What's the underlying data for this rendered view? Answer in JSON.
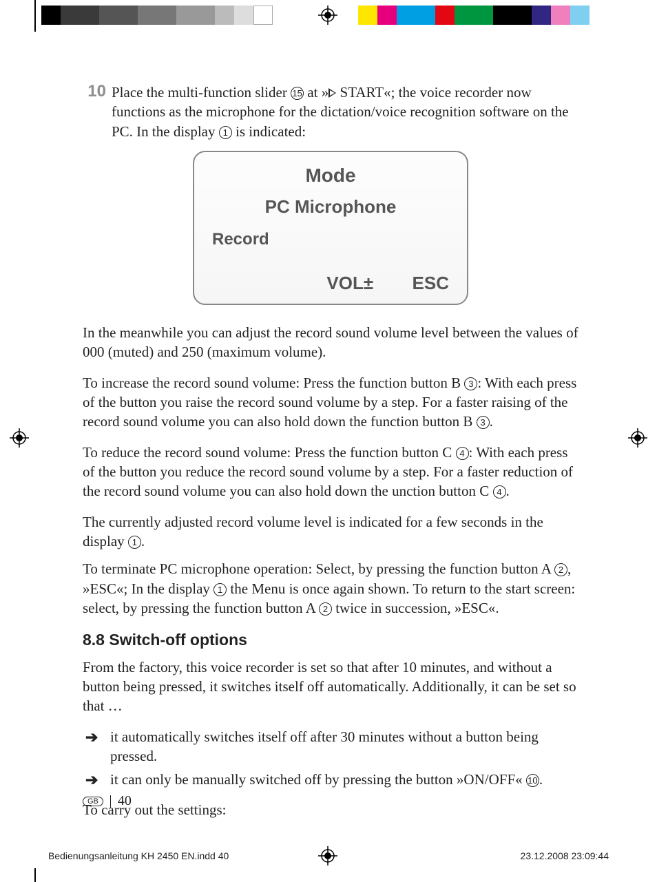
{
  "step": {
    "number": "10",
    "text_a": "Place the multi-function slider ",
    "ref15": "15",
    "text_b": " at »",
    "text_c": " START«; the voice recorder now functions as the microphone for the dictation/voice recognition software on the PC. In the display ",
    "ref1": "1",
    "text_d": " is indicated:"
  },
  "lcd": {
    "mode": "Mode",
    "sub": "PC Microphone",
    "rec": "Record",
    "vol": "VOL±",
    "esc": "ESC"
  },
  "p1": "In the meanwhile you can adjust the record sound volume level between the values of 000 (muted) and 250 (maximum volume).",
  "p2": {
    "a": "To increase the record sound volume: Press the function button B ",
    "ref3a": "3",
    "b": ": With each press of the button you raise the record sound volume by a step. For a faster raising of the record sound volume you can also hold down the function button B ",
    "ref3b": "3",
    "c": "."
  },
  "p3": {
    "a": "To reduce the record sound volume: Press the function button C ",
    "ref4a": "4",
    "b": ": With each press of the button you reduce the record sound volume by a step. For a faster reduction of the record sound volume you can also hold down the unction button C ",
    "ref4b": "4",
    "c": "."
  },
  "p4": {
    "a": "The currently adjusted record volume level is indicated for a few seconds in the display ",
    "ref1": "1",
    "b": "."
  },
  "p5": {
    "a": "To terminate PC microphone operation: Select, by pressing the function button A ",
    "ref2a": "2",
    "b": ", »ESC«; In the display ",
    "ref1": "1",
    "c": " the Menu is once again shown. To return to the start screen: select, by pressing the function button A ",
    "ref2b": "2",
    "d": " twice in succession, »ESC«."
  },
  "h2": "8.8 Switch-off options",
  "p6": "From the factory, this voice recorder is set so that after 10 minutes, and without a button being pressed, it switches itself off automatically. Additionally, it can be set so that …",
  "bullets": [
    "it automatically switches itself off after 30 minutes without a button being pressed.",
    {
      "a": "it can only be manually switched off by pressing the button »ON/OFF« ",
      "ref10": "10",
      "b": "."
    }
  ],
  "p7": "To carry out the settings:",
  "footer": {
    "gb": "GB",
    "page": "40"
  },
  "slug": {
    "left": "Bedienungsanleitung KH 2450 EN.indd   40",
    "right": "23.12.2008   23:09:44"
  }
}
